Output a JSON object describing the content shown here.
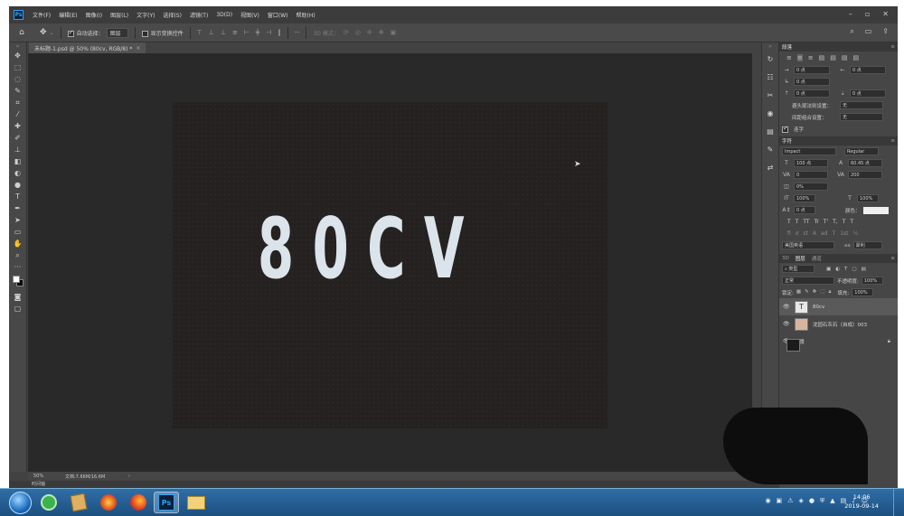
{
  "app": {
    "logo": "Ps"
  },
  "menu": [
    "文件(F)",
    "编辑(E)",
    "图像(I)",
    "图层(L)",
    "文字(Y)",
    "选择(S)",
    "滤镜(T)",
    "3D(D)",
    "视图(V)",
    "窗口(W)",
    "帮助(H)"
  ],
  "window_controls": [
    "–",
    "▫",
    "✕"
  ],
  "options": {
    "auto_select_label": "自动选择：",
    "auto_select_value": "图层",
    "show_transform_label": "显示变换控件",
    "mode3d_label": "3D 模式：",
    "more": "···"
  },
  "document": {
    "tab_title": "未标题-1.psd @ 50% (80cv, RGB/8) *",
    "canvas_text": "80CV"
  },
  "status": {
    "zoom": "50%",
    "doc_size": "文档:7.66M/16.6M",
    "arrow": "›"
  },
  "timeline_label": "时间轴",
  "paragraph": {
    "title": "段落",
    "indent_left": "0 点",
    "indent_right": "0 点",
    "indent_first": "0 点",
    "space_before": "0 点",
    "space_after": "0 点",
    "kinsoku_label": "避头尾法则设置：",
    "kinsoku_value": "无",
    "spacing_label": "间距组合设置：",
    "spacing_value": "无",
    "hyphenate_label": "连字"
  },
  "character": {
    "title": "字符",
    "font_family": "Impact",
    "font_style": "Regular",
    "font_size": "100 点",
    "leading": "60.45 点",
    "kerning": "0",
    "tracking": "200",
    "tsume": "0%",
    "vscale": "100%",
    "hscale": "100%",
    "baseline": "0 点",
    "color_label": "颜色：",
    "color": "#f0f0f0",
    "language": "美国英语",
    "aa_label": "aa",
    "aa_value": "犀利",
    "style_buttons": [
      "T",
      "T",
      "TT",
      "Tr",
      "T'",
      "T,",
      "T",
      "T"
    ],
    "opentype_buttons": [
      "fi",
      "ơ",
      "st",
      "A",
      "ad",
      "T",
      "1st",
      "½"
    ]
  },
  "layers": {
    "tabs": [
      "3D",
      "图层",
      "通道"
    ],
    "filter_label": "类型",
    "blend_mode": "正常",
    "opacity_label": "不透明度:",
    "opacity": "100%",
    "lock_label": "锁定:",
    "fill_label": "填充:",
    "fill": "100%",
    "items": [
      {
        "name": "80cv",
        "kind": "text"
      },
      {
        "name": "沈园石灰石（自成）003",
        "kind": "image"
      },
      {
        "name": "背景",
        "kind": "background"
      }
    ]
  },
  "taskbar": {
    "apps": [
      "360",
      "Firefox",
      "Ps"
    ],
    "time": "14:06",
    "date": "2019-09-14"
  }
}
